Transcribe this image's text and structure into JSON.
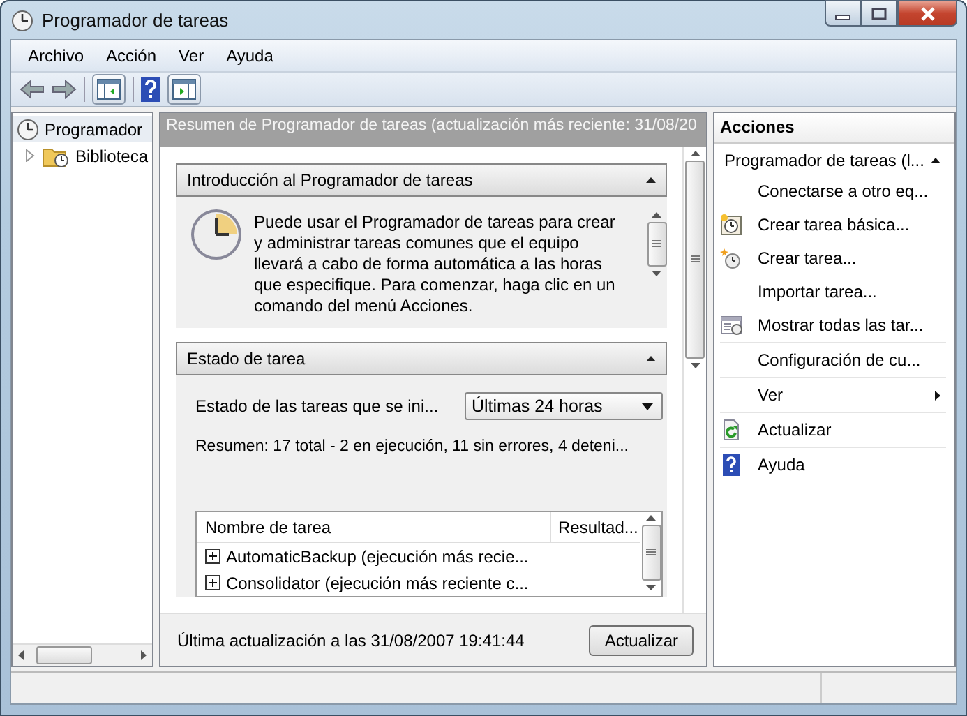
{
  "window": {
    "title": "Programador de tareas"
  },
  "menu": [
    "Archivo",
    "Acción",
    "Ver",
    "Ayuda"
  ],
  "tree": [
    {
      "label": "Programador",
      "selected": true,
      "children": [
        {
          "label": "Biblioteca",
          "selected": false,
          "expanded": false
        }
      ]
    }
  ],
  "summary": {
    "header": "Resumen de Programador de tareas (actualización más reciente: 31/08/20",
    "sections": [
      {
        "kind": "intro",
        "title": "Introducción al Programador de tareas",
        "expanded": true,
        "text": "Puede usar el Programador de tareas para crear y administrar tareas comunes que el equipo llevará a cabo de forma automática a las horas que especifique. Para comenzar, haga clic en un comando del menú Acciones."
      },
      {
        "kind": "status",
        "title": "Estado de tarea",
        "expanded": true,
        "filter_label": "Estado de las tareas que se ini...",
        "filter_value": "Últimas 24 horas",
        "summary": "Resumen: 17 total - 2 en ejecución, 11 sin errores, 4 deteni...",
        "table": {
          "columns": [
            "Nombre de tarea",
            "Resultad..."
          ],
          "rows": [
            {
              "name": "AutomaticBackup (ejecución más recie...",
              "expanded": false
            },
            {
              "name": "Consolidator (ejecución más reciente c...",
              "expanded": false
            }
          ]
        }
      }
    ],
    "footer_text": "Última actualización a las 31/08/2007 19:41:44",
    "refresh_button": "Actualizar"
  },
  "actions": {
    "title": "Acciones",
    "group": "Programador de tareas  (l...",
    "group_expanded": true,
    "items": [
      {
        "label": "Conectarse a otro eq...",
        "kind": "action",
        "divider": false
      },
      {
        "label": "Crear tarea básica...",
        "kind": "action",
        "divider": false
      },
      {
        "label": "Crear tarea...",
        "kind": "action",
        "divider": false
      },
      {
        "label": "Importar tarea...",
        "kind": "action",
        "divider": false
      },
      {
        "label": "Mostrar todas las tar...",
        "kind": "action",
        "divider": true
      },
      {
        "label": "Configuración de cu...",
        "kind": "action",
        "divider": true
      },
      {
        "label": "Ver",
        "kind": "submenu",
        "divider": true
      },
      {
        "label": "Actualizar",
        "kind": "action",
        "divider": true
      },
      {
        "label": "Ayuda",
        "kind": "action",
        "divider": false
      }
    ]
  }
}
